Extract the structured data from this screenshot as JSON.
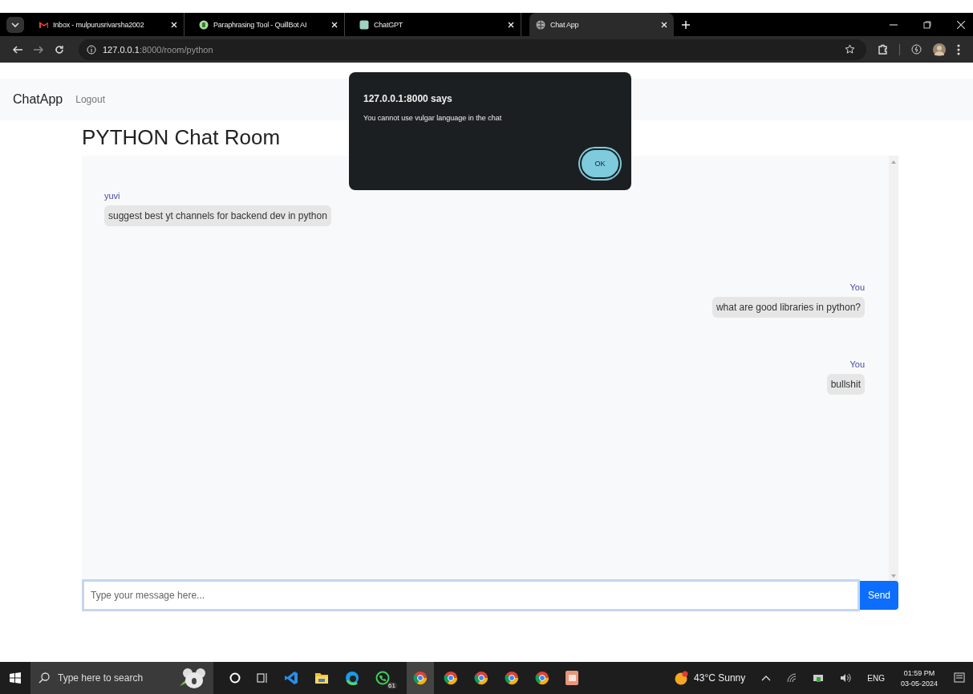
{
  "browser": {
    "tabs": [
      {
        "title": "Inbox - mulpurusrivarsha2002",
        "kind": "mail",
        "selected": false
      },
      {
        "title": "Paraphrasing Tool - QuillBot AI",
        "kind": "quill",
        "selected": false
      },
      {
        "title": "ChatGPT",
        "kind": "chat",
        "selected": false
      },
      {
        "title": "Chat App",
        "kind": "globe",
        "selected": true
      }
    ],
    "address": {
      "host": "127.0.0.1",
      "rest": ":8000/room/python"
    }
  },
  "navbar": {
    "brand": "ChatApp",
    "links": [
      "Logout"
    ]
  },
  "room": {
    "title": "PYTHON Chat Room",
    "messages": [
      {
        "sender": "yuvi",
        "text": "suggest best yt channels for backend dev in python",
        "kind": "incoming"
      },
      {
        "sender": "You",
        "text": "what are good libraries in python?",
        "kind": "outgoing"
      },
      {
        "sender": "You",
        "text": "bullshit",
        "kind": "outgoing"
      }
    ],
    "composer": {
      "placeholder": "Type your message here...",
      "button": "Send"
    }
  },
  "dialog": {
    "title": "127.0.0.1:8000 says",
    "message": "You cannot use vulgar language in the chat",
    "button": "OK"
  },
  "taskbar": {
    "search_placeholder": "Type here to search",
    "badge": "61",
    "weather": "43°C  Sunny",
    "language": "ENG",
    "time": "01:59 PM",
    "date": "03-05-2024"
  }
}
